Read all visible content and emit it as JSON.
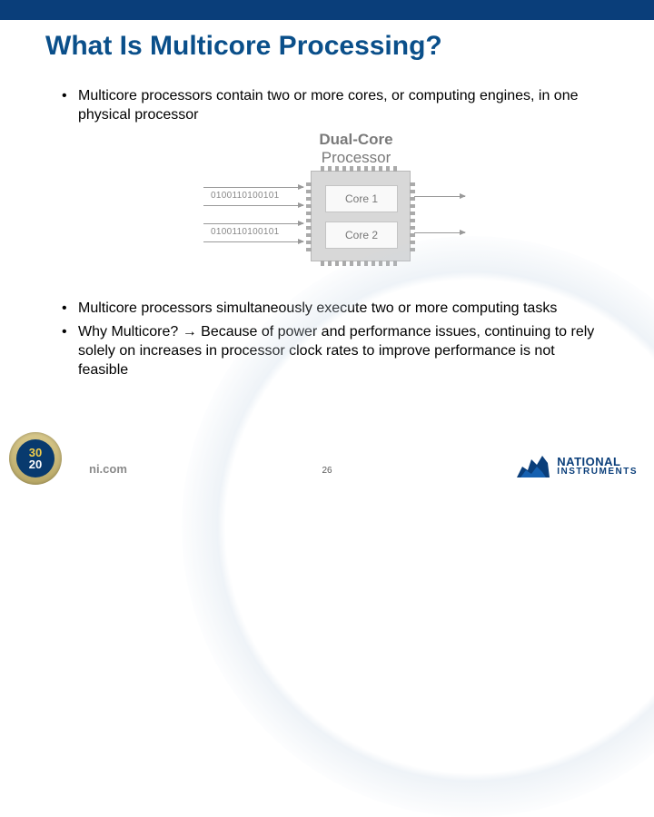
{
  "title": "What Is Multicore Processing?",
  "bullets_top": [
    "Multicore processors contain two or more cores, or computing engines, in one physical processor"
  ],
  "diagram": {
    "title_line1": "Dual-Core",
    "title_line2": "Processor",
    "binary1": "0100110100101",
    "binary2": "0100110100101",
    "core1_label": "Core 1",
    "core2_label": "Core 2"
  },
  "bullets_bottom": [
    "Multicore processors simultaneously execute two or more computing tasks",
    "Why Multicore? → Because of power and performance issues, continuing to rely solely on increases in processor clock rates to improve performance is not feasible"
  ],
  "footer": {
    "seal_top": "30",
    "seal_bottom": "20",
    "site": "ni.com",
    "slide_number": "26",
    "logo_line1": "NATIONAL",
    "logo_line2": "INSTRUMENTS"
  }
}
